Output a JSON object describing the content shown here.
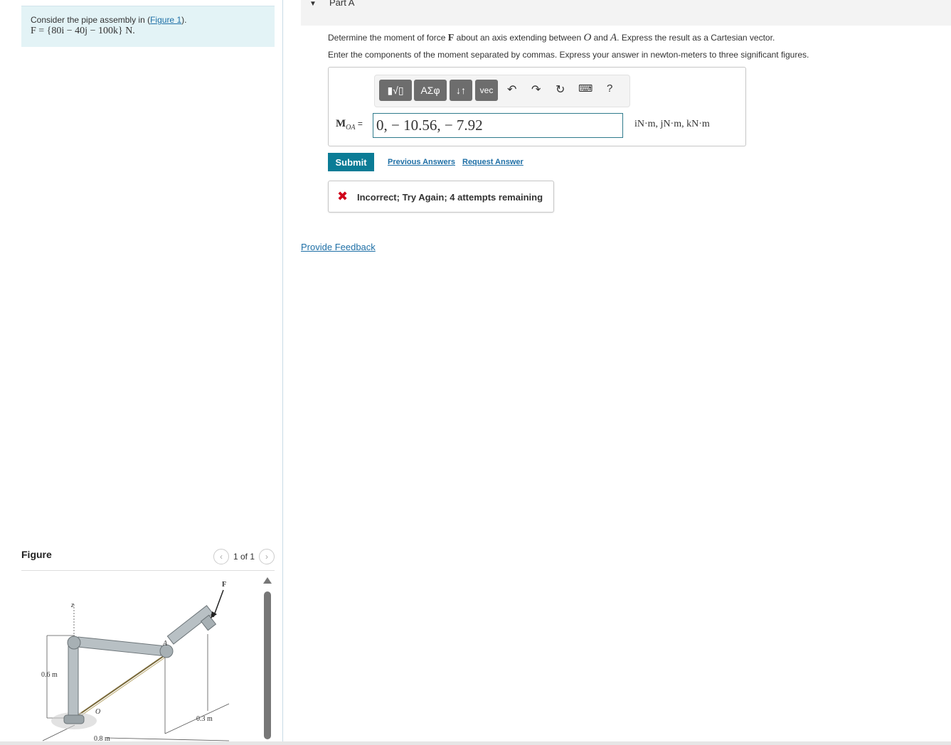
{
  "problem": {
    "intro": "Consider the pipe assembly in (",
    "figure_link": "Figure 1",
    "intro_end": ").",
    "equation": "F = {80i − 40j − 100k} N."
  },
  "figure": {
    "title": "Figure",
    "pager": "1 of 1",
    "labels": {
      "z": "z",
      "F": "F",
      "A": "A",
      "O": "O",
      "h": "0.6 m",
      "d1": "0.3 m",
      "d2": "0.8 m"
    }
  },
  "part": {
    "title": "Part A",
    "question_pre": "Determine the moment of force ",
    "question_F": "F",
    "question_mid": " about an axis extending between ",
    "question_O": "O",
    "question_and": " and ",
    "question_A": "A",
    "question_post": ". Express the result as a Cartesian vector.",
    "instructions": "Enter the components of the moment separated by commas. Express your answer in newton-meters to three significant figures."
  },
  "toolbar": {
    "templates": "▮√▯",
    "greek": "ΑΣφ",
    "arrows": "↓↑",
    "vec": "vec",
    "undo": "↶",
    "redo": "↷",
    "reset": "↻",
    "keyboard": "⌨",
    "help": "?"
  },
  "answer": {
    "label_main": "M",
    "label_sub": "OA",
    "label_eq": " =",
    "value": "0, − 10.56, − 7.92",
    "units": "iN·m, jN·m, kN·m"
  },
  "actions": {
    "submit": "Submit",
    "previous": "Previous Answers",
    "request": "Request Answer"
  },
  "feedback": {
    "icon": "✖",
    "text": "Incorrect; Try Again; 4 attempts remaining"
  },
  "provide_feedback": "Provide Feedback"
}
